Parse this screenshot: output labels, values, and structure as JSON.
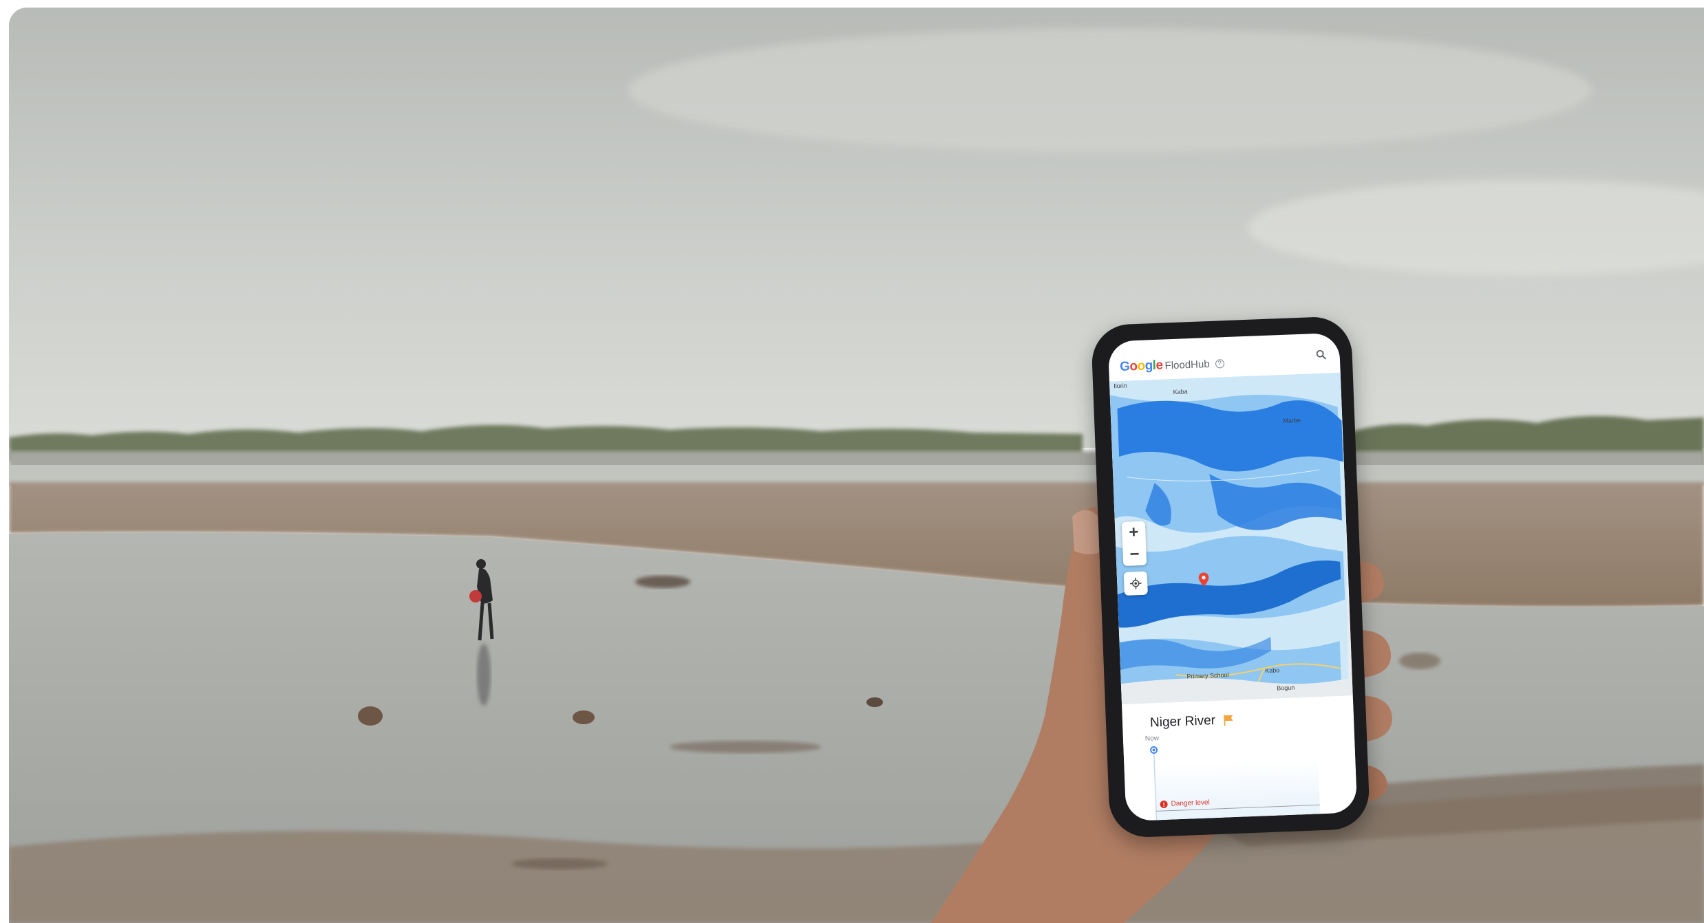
{
  "scene": {
    "description_colors": {
      "sky": "#c9ccc8",
      "water": "#a9aca8",
      "sand": "#9f8a74",
      "trees": "#6f7a5e"
    }
  },
  "app": {
    "brand_letters": [
      "G",
      "o",
      "o",
      "g",
      "l",
      "e"
    ],
    "name": "FloodHub",
    "help_icon": "?",
    "search_icon": "search-icon"
  },
  "map": {
    "labels": {
      "top_left": "Ilorin",
      "top": "Kaba",
      "right": "Marbe",
      "bottom_school": "Primary School",
      "bottom_right1": "Kabo",
      "bottom_right2": "Bogun"
    },
    "colors": {
      "flood_dark": "#2a7de1",
      "flood_light": "#8fc7f2",
      "flood_pale": "#cfe8f8",
      "land": "#e9ecee"
    },
    "zoom_in": "+",
    "zoom_out": "−"
  },
  "sheet": {
    "title": "Niger River",
    "now_label": "Now",
    "danger_label": "Danger level",
    "danger_icon": "!",
    "flag_color": "#f6a33b"
  }
}
